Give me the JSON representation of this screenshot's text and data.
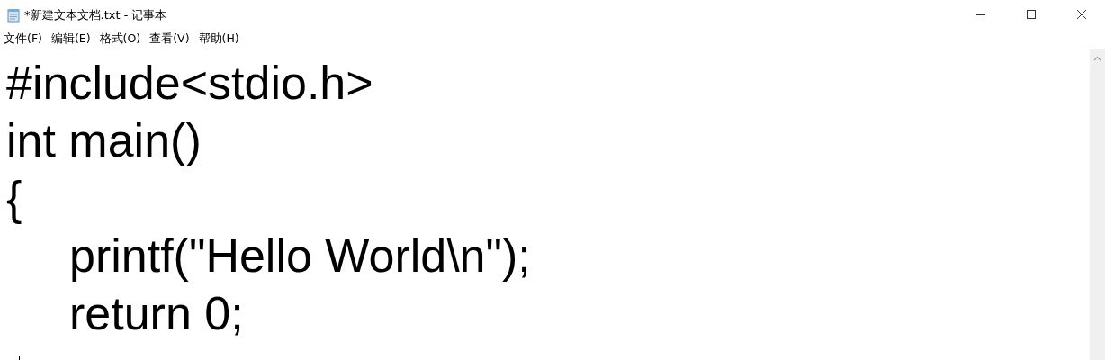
{
  "window": {
    "title": "*新建文本文档.txt - 记事本"
  },
  "menu": [
    "文件(F)",
    "编辑(E)",
    "格式(O)",
    "查看(V)",
    "帮助(H)"
  ],
  "editor": {
    "lines": [
      "#include<stdio.h>",
      "int main()",
      "{",
      "\tprintf(\"Hello World\\n\");",
      "\treturn 0;"
    ]
  }
}
